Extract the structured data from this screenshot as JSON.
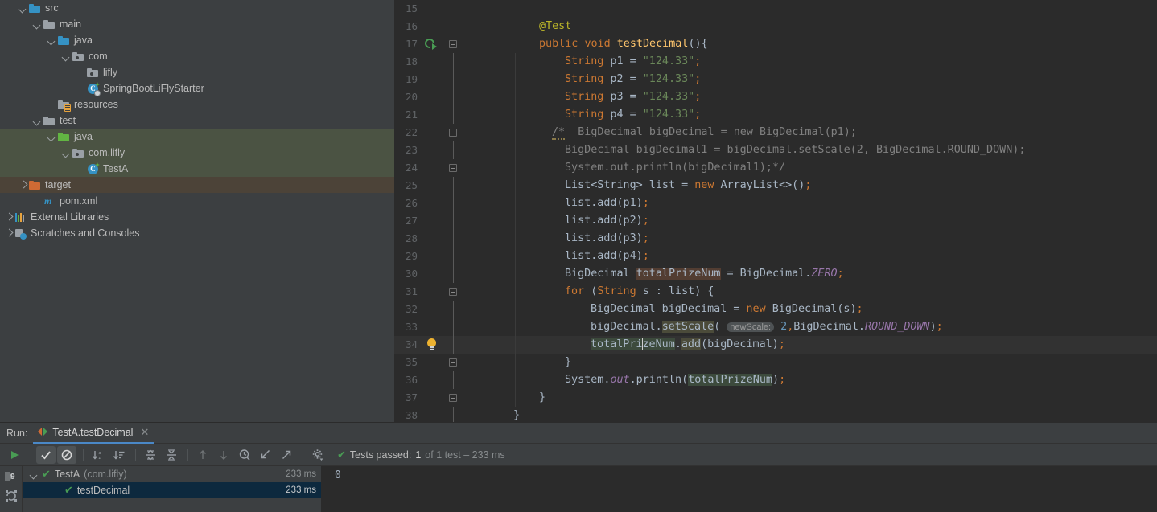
{
  "project_tree": {
    "items": [
      {
        "label": "src",
        "indent": 1,
        "arrow": "expanded",
        "icon": "folder-blue"
      },
      {
        "label": "main",
        "indent": 2,
        "arrow": "expanded",
        "icon": "folder-grey"
      },
      {
        "label": "java",
        "indent": 3,
        "arrow": "expanded",
        "icon": "folder-blue-src"
      },
      {
        "label": "com",
        "indent": 4,
        "arrow": "expanded",
        "icon": "package"
      },
      {
        "label": "lifly",
        "indent": 5,
        "arrow": "none",
        "icon": "package"
      },
      {
        "label": "SpringBootLiFlyStarter",
        "indent": 5,
        "arrow": "none",
        "icon": "spring-class"
      },
      {
        "label": "resources",
        "indent": 3,
        "arrow": "none",
        "icon": "folder-resources"
      },
      {
        "label": "test",
        "indent": 2,
        "arrow": "expanded",
        "icon": "folder-grey"
      },
      {
        "label": "java",
        "indent": 3,
        "arrow": "expanded",
        "icon": "folder-green",
        "highlight": "test"
      },
      {
        "label": "com.lifly",
        "indent": 4,
        "arrow": "expanded",
        "icon": "package",
        "highlight": "test"
      },
      {
        "label": "TestA",
        "indent": 5,
        "arrow": "none",
        "icon": "test-class",
        "highlight": "test"
      },
      {
        "label": "target",
        "indent": 1,
        "arrow": "collapsed",
        "icon": "folder-orange",
        "highlight": "target"
      },
      {
        "label": "pom.xml",
        "indent": 2,
        "arrow": "none",
        "icon": "maven"
      },
      {
        "label": "External Libraries",
        "indent": 0,
        "arrow": "collapsed",
        "icon": "libraries"
      },
      {
        "label": "Scratches and Consoles",
        "indent": 0,
        "arrow": "collapsed",
        "icon": "scratches"
      }
    ]
  },
  "editor": {
    "first_line": 15,
    "caret_line": 34,
    "lines": [
      {
        "n": "15",
        "text": ""
      },
      {
        "n": "16",
        "text": "        @Test"
      },
      {
        "n": "17",
        "text": "        public void testDecimal(){"
      },
      {
        "n": "18",
        "text": "            String p1 = \"124.33\";"
      },
      {
        "n": "19",
        "text": "            String p2 = \"124.33\";"
      },
      {
        "n": "20",
        "text": "            String p3 = \"124.33\";"
      },
      {
        "n": "21",
        "text": "            String p4 = \"124.33\";"
      },
      {
        "n": "22",
        "text": "      /*  BigDecimal bigDecimal = new BigDecimal(p1);"
      },
      {
        "n": "23",
        "text": "          BigDecimal bigDecimal1 = bigDecimal.setScale(2, BigDecimal.ROUND_DOWN);"
      },
      {
        "n": "24",
        "text": "          System.out.println(bigDecimal1);*/"
      },
      {
        "n": "25",
        "text": "            List<String> list = new ArrayList<>();"
      },
      {
        "n": "26",
        "text": "            list.add(p1);"
      },
      {
        "n": "27",
        "text": "            list.add(p2);"
      },
      {
        "n": "28",
        "text": "            list.add(p3);"
      },
      {
        "n": "29",
        "text": "            list.add(p4);"
      },
      {
        "n": "30",
        "text": "            BigDecimal totalPrizeNum = BigDecimal.ZERO;"
      },
      {
        "n": "31",
        "text": "            for (String s : list) {"
      },
      {
        "n": "32",
        "text": "                BigDecimal bigDecimal = new BigDecimal(s);"
      },
      {
        "n": "33",
        "text": "                bigDecimal.setScale( newScale: 2,BigDecimal.ROUND_DOWN);"
      },
      {
        "n": "34",
        "text": "                totalPrizeNum.add(bigDecimal);"
      },
      {
        "n": "35",
        "text": "            }"
      },
      {
        "n": "36",
        "text": "            System.out.println(totalPrizeNum);"
      },
      {
        "n": "37",
        "text": "        }"
      },
      {
        "n": "38",
        "text": "    }"
      }
    ],
    "param_hint": "newScale:"
  },
  "run_panel": {
    "run_label": "Run:",
    "tab": {
      "title": "TestA.testDecimal",
      "close": "✕"
    },
    "toolbar": {
      "buttons": [
        {
          "name": "rerun-button",
          "glyph": "play"
        },
        {
          "name": "show-passed-toggle",
          "glyph": "check",
          "active": true
        },
        {
          "name": "show-ignored-toggle",
          "glyph": "ignore",
          "active": true
        },
        {
          "name": "sort-alphabetically",
          "glyph": "sort-alpha"
        },
        {
          "name": "sort-by-duration",
          "glyph": "sort-dur"
        },
        {
          "name": "expand-all",
          "glyph": "expand-all"
        },
        {
          "name": "collapse-all",
          "glyph": "collapse-all"
        },
        {
          "name": "prev-failed-test",
          "glyph": "arrow-up"
        },
        {
          "name": "next-failed-test",
          "glyph": "arrow-down"
        },
        {
          "name": "test-history",
          "glyph": "history"
        },
        {
          "name": "import-tests",
          "glyph": "import"
        },
        {
          "name": "export-tests",
          "glyph": "export"
        },
        {
          "name": "test-settings",
          "glyph": "gear"
        }
      ]
    },
    "status": {
      "tick": "✔",
      "prefix": "Tests passed:",
      "count": "1",
      "suffix": "of 1 test – 233 ms"
    },
    "side_buttons": [
      {
        "name": "debugger-button",
        "glyph": "debug-9"
      },
      {
        "name": "rerun-failed-button",
        "glyph": "rerun-circle"
      }
    ],
    "tree": [
      {
        "label": "TestA",
        "suffix": "(com.lifly)",
        "time": "233 ms",
        "arrow": "expanded",
        "indent": 0,
        "selected": false
      },
      {
        "label": "testDecimal",
        "suffix": "",
        "time": "233 ms",
        "arrow": "none",
        "indent": 1,
        "selected": true
      }
    ],
    "console_output": "0"
  },
  "colors": {
    "editor_bg": "#2b2b2b",
    "panel_bg": "#3c3f41",
    "accent_blue": "#4a88c7",
    "pass_green": "#499c54",
    "keyword_orange": "#cc7832",
    "string_green": "#6a8759",
    "number_blue": "#6897bb",
    "annotation_yellow": "#bbb529",
    "comment_grey": "#808080",
    "field_purple": "#9876aa",
    "test_src_bg": "#4b5343",
    "target_bg": "#4c4338",
    "selection_blue": "#0d293e"
  }
}
